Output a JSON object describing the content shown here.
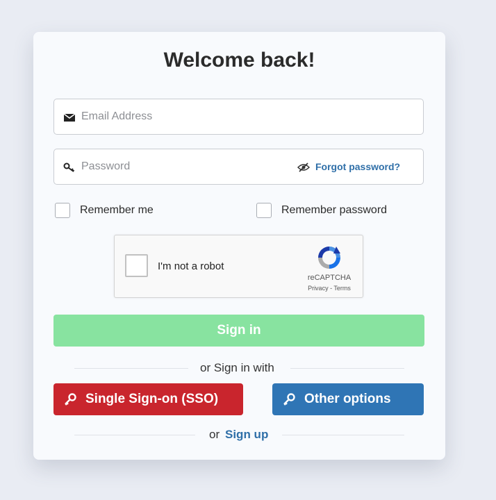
{
  "title": "Welcome back!",
  "email": {
    "placeholder": "Email Address",
    "icon": "envelope-icon"
  },
  "password": {
    "placeholder": "Password",
    "icon": "key-icon",
    "toggle_icon": "eye-slash-icon",
    "forgot_label": "Forgot password?"
  },
  "remember_me": {
    "label": "Remember me",
    "checked": false
  },
  "remember_password": {
    "label": "Remember password",
    "checked": false
  },
  "recaptcha": {
    "label": "I'm not a robot",
    "brand": "reCAPTCHA",
    "privacy": "Privacy",
    "separator": " - ",
    "terms": "Terms"
  },
  "sign_in_label": "Sign in",
  "alt_divider_text": "or Sign in with",
  "sso_button": {
    "label": "Single Sign-on (SSO)",
    "icon": "key-icon",
    "color": "#c9252d"
  },
  "other_button": {
    "label": "Other options",
    "icon": "key-icon",
    "color": "#2f75b5"
  },
  "signup_prefix": "or",
  "signup_label": "Sign up",
  "colors": {
    "accent": "#2f6fa8",
    "sign_in": "#88e3a0"
  }
}
